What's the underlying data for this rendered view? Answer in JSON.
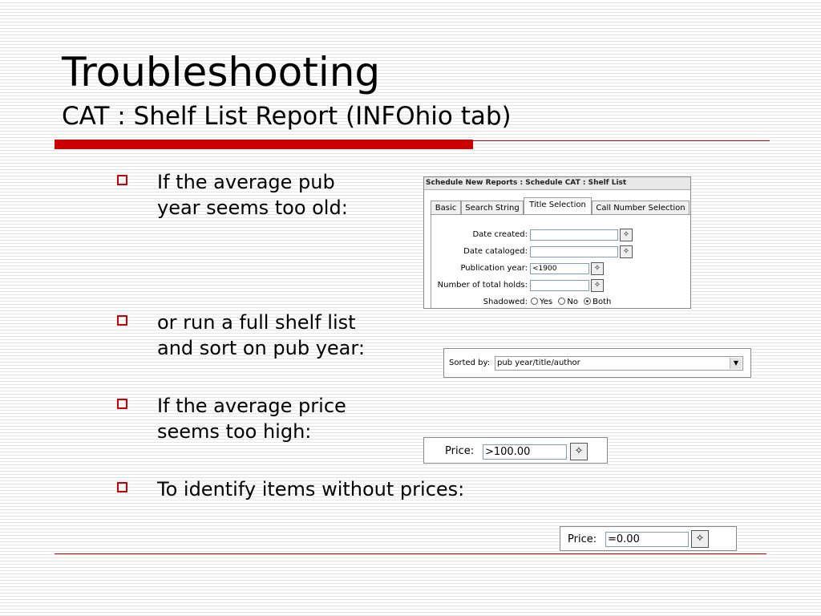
{
  "slide": {
    "title": "Troubleshooting",
    "subtitle": "CAT : Shelf List Report (INFOhio tab)"
  },
  "bullets": [
    {
      "text": "If the average pub\nyear seems too old:"
    },
    {
      "text": "or run a full shelf list\nand sort on pub year:"
    },
    {
      "text": "If the average price\nseems too high:"
    },
    {
      "text": "To identify items without prices:"
    }
  ],
  "report_panel": {
    "header": "Schedule New Reports : Schedule CAT : Shelf List",
    "tabs": [
      {
        "label": "Basic",
        "active": false
      },
      {
        "label": "Search String",
        "active": false
      },
      {
        "label": "Title Selection",
        "active": true
      },
      {
        "label": "Call Number Selection",
        "active": false
      }
    ],
    "fields": [
      {
        "label": "Date created:",
        "value": ""
      },
      {
        "label": "Date cataloged:",
        "value": ""
      },
      {
        "label": "Publication year:",
        "value": "<1900"
      },
      {
        "label": "Number of total holds:",
        "value": ""
      }
    ],
    "shadowed": {
      "label": "Shadowed:",
      "options": [
        "Yes",
        "No",
        "Both"
      ],
      "selected": "Both"
    }
  },
  "sort_panel": {
    "label": "Sorted by:",
    "value": "pub year/title/author"
  },
  "price_panel_high": {
    "label": "Price:",
    "value": ">100.00"
  },
  "price_panel_zero": {
    "label": "Price:",
    "value": "=0.00"
  },
  "icons": {
    "lookup": "gavel-lookup-icon",
    "dropdown": "chevron-down-icon",
    "bullet": "square-bullet-icon"
  },
  "colors": {
    "accent": "#cc0000"
  }
}
